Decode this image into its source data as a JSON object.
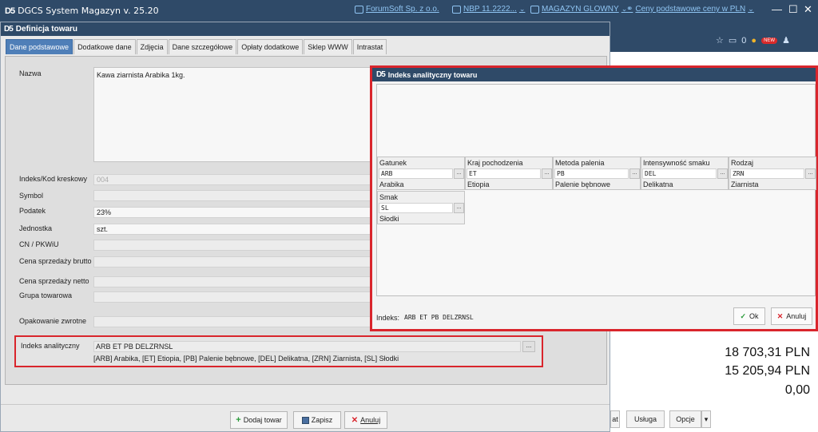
{
  "app": {
    "logo": "D5",
    "title": "DGCS System Magazyn  v. 25.20",
    "company": "ForumSoft Sp. z o.o.",
    "nbp": "NBP 11.2222...",
    "warehouse": "MAGAZYN GLOWNY",
    "prices": "Ceny podstawowe ceny w PLN"
  },
  "bg": {
    "notif_count": "0",
    "badge": "NEW",
    "amounts": [
      "18 703,31 PLN",
      "15 205,94 PLN",
      "0,00"
    ],
    "buttons": [
      "at",
      "Usługa",
      "Opcje",
      "▾"
    ]
  },
  "main": {
    "title": "Definicja towaru",
    "tabs": [
      "Dane podstawowe",
      "Dodatkowe dane",
      "Zdjęcia",
      "Dane szczegółowe",
      "Opłaty dodatkowe",
      "Sklep WWW",
      "Intrastat"
    ],
    "fields": {
      "nazwa_label": "Nazwa",
      "nazwa_value": "Kawa ziarnista Arabika 1kg.",
      "indeks_label": "Indeks/Kod kreskowy",
      "indeks_value": "004",
      "symbol_label": "Symbol",
      "podatek_label": "Podatek",
      "podatek_value": "23%",
      "jednostka_label": "Jednostka",
      "jednostka_value": "szt.",
      "cn_label": "CN / PKWiU",
      "brutto_label": "Cena sprzedaży brutto",
      "netto_label": "Cena sprzedaży netto",
      "grupa_label": "Grupa towarowa",
      "opakowanie_label": "Opakowanie zwrotne"
    },
    "index": {
      "label": "Indeks analityczny",
      "value": "ARB ET PB DELZRNSL",
      "description": "[ARB] Arabika, [ET] Etiopia, [PB] Palenie bębnowe, [DEL] Delikatna, [ZRN] Ziarnista, [SL] Słodki"
    },
    "buttons": {
      "add": "Dodaj towar",
      "save": "Zapisz",
      "cancel": "Anuluj"
    }
  },
  "dialog": {
    "title": "Indeks analityczny towaru",
    "segments": [
      {
        "header": "Gatunek",
        "code": "ARB",
        "desc": "Arabika"
      },
      {
        "header": "Kraj pochodzenia",
        "code": "ET",
        "desc": "Etiopia"
      },
      {
        "header": "Metoda palenia",
        "code": "PB",
        "desc": "Palenie bębnowe"
      },
      {
        "header": "Intensywność smaku",
        "code": "DEL",
        "desc": "Delikatna"
      },
      {
        "header": "Rodzaj",
        "code": "ZRN",
        "desc": "Ziarnista"
      },
      {
        "header": "Smak",
        "code": "SL",
        "desc": "Słodki"
      }
    ],
    "footer_label": "Indeks:",
    "footer_value": "ARB ET PB DELZRNSL",
    "ok": "Ok",
    "cancel": "Anuluj",
    "dots": "..."
  }
}
